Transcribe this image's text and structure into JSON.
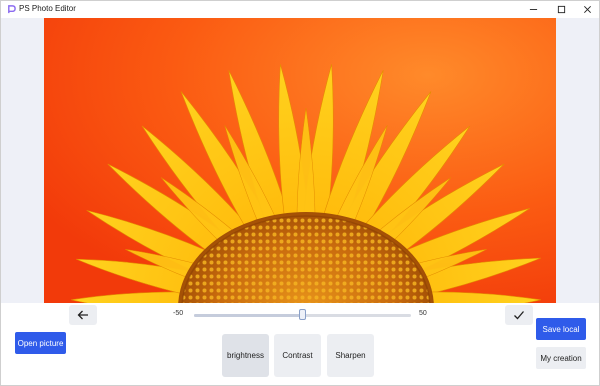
{
  "window": {
    "title": "PS Photo Editor",
    "icon": "app-logo-icon"
  },
  "editor": {
    "slider": {
      "min_label": "-50",
      "max_label": "50",
      "value": 0
    },
    "back_icon": "arrow-left-icon",
    "confirm_icon": "checkmark-icon"
  },
  "actions": {
    "open_label": "Open picture",
    "save_label": "Save local",
    "creation_label": "My creation"
  },
  "tools": [
    {
      "label": "brightness",
      "selected": true
    },
    {
      "label": "Contrast",
      "selected": false
    },
    {
      "label": "Sharpen",
      "selected": false
    }
  ],
  "colors": {
    "accent": "#2f5bea",
    "panel": "#eef0f7",
    "button_gray": "#eceef2"
  }
}
